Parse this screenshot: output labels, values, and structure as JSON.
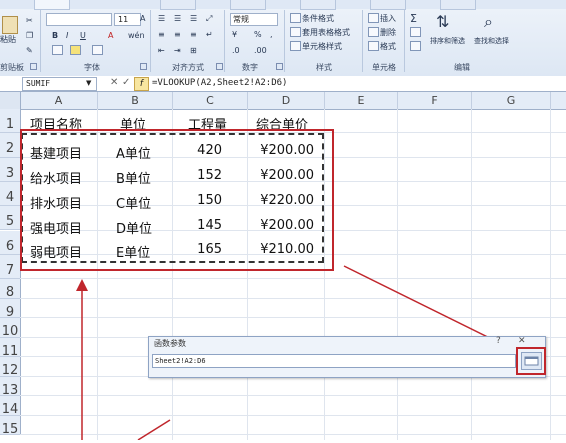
{
  "ribbon": {
    "clipboard": {
      "paste_label": "粘贴",
      "group_label": "剪贴板"
    },
    "font": {
      "size_value": "11",
      "bold": "B",
      "italic": "I",
      "underline": "U",
      "grow": "A",
      "wen": "wén",
      "group_label": "字体"
    },
    "alignment": {
      "group_label": "对齐方式"
    },
    "number": {
      "format_value": "常规",
      "percent": "%",
      "comma": ",",
      "group_label": "数字"
    },
    "styles": {
      "conditional": "条件格式",
      "table": "套用表格格式",
      "cell": "单元格样式",
      "group_label": "样式"
    },
    "cells": {
      "insert": "插入",
      "delete": "删除",
      "format": "格式",
      "group_label": "单元格"
    },
    "editing": {
      "sigma": "Σ",
      "sort_filter": "排序和筛选",
      "find_select": "查找和选择",
      "group_label": "编辑"
    }
  },
  "formula_bar": {
    "name_box": "SUMIF",
    "cancel": "✕",
    "enter": "✓",
    "fx": "f",
    "formula": "=VLOOKUP(A2,Sheet2!A2:D6)"
  },
  "columns": [
    "A",
    "B",
    "C",
    "D",
    "E",
    "F",
    "G"
  ],
  "rows": [
    "1",
    "2",
    "3",
    "4",
    "5",
    "6",
    "7",
    "8",
    "9",
    "10",
    "11",
    "12",
    "13",
    "14",
    "15"
  ],
  "header": [
    "项目名称",
    "单位",
    "工程量",
    "综合单价"
  ],
  "table": [
    [
      "基建项目",
      "A单位",
      "420",
      "¥200.00"
    ],
    [
      "给水项目",
      "B单位",
      "152",
      "¥200.00"
    ],
    [
      "排水项目",
      "C单位",
      "150",
      "¥220.00"
    ],
    [
      "强电项目",
      "D单位",
      "145",
      "¥200.00"
    ],
    [
      "弱电项目",
      "E单位",
      "165",
      "¥210.00"
    ]
  ],
  "dialog": {
    "title": "函数参数",
    "help": "?",
    "close": "✕",
    "input_value": "Sheet2!A2:D6"
  },
  "colors": {
    "annotation": "#c0262c",
    "ribbon": "#dde7f4",
    "header": "#e4ecf7"
  }
}
